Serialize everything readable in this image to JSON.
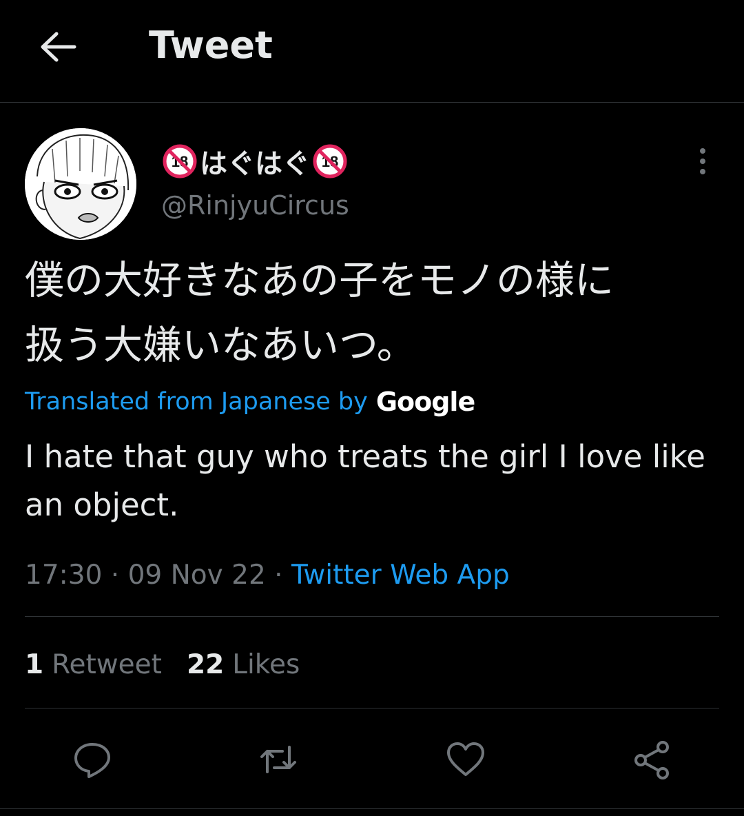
{
  "header": {
    "title": "Tweet",
    "back_icon": "arrow-left-icon"
  },
  "author": {
    "display_name": "はぐはぐ",
    "handle": "@RinjyuCircus",
    "badge_icon": "no-under-18-icon"
  },
  "tweet": {
    "original_text": "僕の大好きなあの子をモノの様に\n扱う大嫌いなあいつ。",
    "translation_label": "Translated from Japanese by",
    "translation_provider": "Google",
    "translated_text": "I hate that guy who treats the girl I love like an object.",
    "time": "17:30",
    "date": "09 Nov 22",
    "separator": " · ",
    "source_app": "Twitter Web App"
  },
  "stats": {
    "retweets_count": "1",
    "retweets_label": "Retweet",
    "likes_count": "22",
    "likes_label": "Likes"
  },
  "actions": [
    "reply-icon",
    "retweet-icon",
    "like-icon",
    "share-icon"
  ],
  "colors": {
    "accent": "#1d9bf0",
    "secondary_text": "#71767b",
    "divider": "#2f3336",
    "background": "#000000"
  }
}
